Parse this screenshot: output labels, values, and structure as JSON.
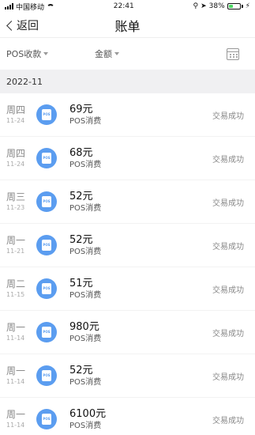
{
  "status_bar": {
    "carrier": "中国移动",
    "time": "22:41",
    "battery": "38%"
  },
  "nav": {
    "back_label": "返回",
    "title": "账单"
  },
  "filters": {
    "pos_label": "POS收款",
    "amount_label": "金额"
  },
  "month": "2022-11",
  "transactions": [
    {
      "weekday": "周四",
      "date": "11-24",
      "amount": "69元",
      "type": "POS消费",
      "status": "交易成功"
    },
    {
      "weekday": "周四",
      "date": "11-24",
      "amount": "68元",
      "type": "POS消费",
      "status": "交易成功"
    },
    {
      "weekday": "周三",
      "date": "11-23",
      "amount": "52元",
      "type": "POS消费",
      "status": "交易成功"
    },
    {
      "weekday": "周一",
      "date": "11-21",
      "amount": "52元",
      "type": "POS消费",
      "status": "交易成功"
    },
    {
      "weekday": "周二",
      "date": "11-15",
      "amount": "51元",
      "type": "POS消费",
      "status": "交易成功"
    },
    {
      "weekday": "周一",
      "date": "11-14",
      "amount": "980元",
      "type": "POS消费",
      "status": "交易成功"
    },
    {
      "weekday": "周一",
      "date": "11-14",
      "amount": "52元",
      "type": "POS消费",
      "status": "交易成功"
    },
    {
      "weekday": "周一",
      "date": "11-14",
      "amount": "6100元",
      "type": "POS消费",
      "status": "交易成功"
    }
  ],
  "icons": {
    "transaction": "pos-card-icon",
    "calendar": "calendar-icon"
  },
  "colors": {
    "accent": "#5b9df0",
    "month_bg": "#f0f0f2"
  }
}
